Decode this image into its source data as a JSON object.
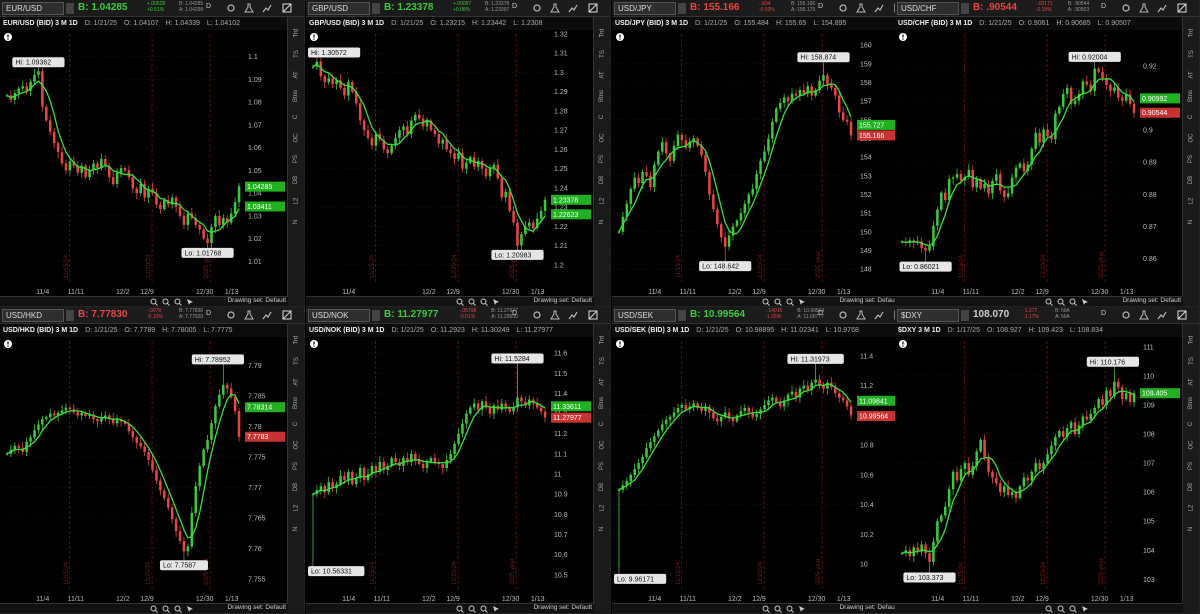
{
  "colors": {
    "up": "#3acb3a",
    "down": "#e84545",
    "ma": "#38e038",
    "bg": "#000000",
    "grid": "#2a2a2a",
    "vline": "#9a1515"
  },
  "panels": [
    {
      "symbol": "EUR/USD",
      "bid": "B: 1.04285",
      "bid_color": "#3acb3a",
      "change": [
        "+.00528",
        "+0.51%"
      ],
      "change_color": "#3acb3a",
      "bidask": [
        "B: 1.04285",
        "A: 1.04299"
      ],
      "info": {
        "title": "EUR/USD (BID) 3 M 1D",
        "d": "D: 1/21/25",
        "o": "O: 1.04107",
        "h": "H: 1.04339",
        "l": "L: 1.04102"
      },
      "hi_label": "Hi: 1.09362",
      "lo_label": "Lo: 1.01768",
      "badges": [
        {
          "text": "1.04285",
          "color": "#20b020"
        },
        {
          "text": "1.03411",
          "color": "#20b020"
        }
      ],
      "drawing": "Drawing set: Default",
      "chart_data": {
        "type": "candlestick",
        "ylim": [
          1.0,
          1.11
        ],
        "yticks": [
          "1.1",
          "1.09",
          "1.08",
          "1.07",
          "1.06",
          "1.05",
          "1.04",
          "1.03",
          "1.02",
          "1.01"
        ],
        "xticks": [
          "11/4",
          "11/11",
          "12/2",
          "12/9",
          "12/30",
          "1/13"
        ],
        "vlines": [
          "11/15/24",
          "12/20/24",
          "2025 year"
        ],
        "close": [
          1.083,
          1.081,
          1.084,
          1.086,
          1.087,
          1.085,
          1.089,
          1.092,
          1.0936,
          1.078,
          1.072,
          1.067,
          1.062,
          1.058,
          1.053,
          1.05,
          1.054,
          1.052,
          1.049,
          1.052,
          1.047,
          1.05,
          1.053,
          1.051,
          1.055,
          1.052,
          1.047,
          1.044,
          1.049,
          1.051,
          1.05,
          1.047,
          1.042,
          1.04,
          1.044,
          1.038,
          1.042,
          1.04,
          1.035,
          1.033,
          1.037,
          1.035,
          1.038,
          1.034,
          1.03,
          1.026,
          1.031,
          1.029,
          1.026,
          1.024,
          1.02,
          1.018,
          1.025,
          1.03,
          1.026,
          1.029,
          1.027,
          1.031,
          1.036,
          1.043
        ],
        "last": 1.04285,
        "hi": 1.09362,
        "lo": 1.01768
      }
    },
    {
      "symbol": "GBP/USD",
      "bid": "B: 1.23378",
      "bid_color": "#3acb3a",
      "change": [
        "+.00097",
        "+0.08%"
      ],
      "change_color": "#3acb3a",
      "bidask": [
        "B: 1.23378",
        "A: 1.23397"
      ],
      "info": {
        "title": "GBP/USD (BID) 3 M 1D",
        "d": "D: 1/21/25",
        "o": "O: 1.23215",
        "h": "H: 1.23442",
        "l": "L: 1.2308"
      },
      "hi_label": "Hi: 1.30572",
      "lo_label": "Lo: 1.20983",
      "badges": [
        {
          "text": "1.23378",
          "color": "#20b020"
        },
        {
          "text": "1.22623",
          "color": "#20b020"
        }
      ],
      "drawing": "Drawing set: Default",
      "chart_data": {
        "type": "candlestick",
        "ylim": [
          1.19,
          1.32
        ],
        "yticks": [
          "1.32",
          "1.31",
          "1.3",
          "1.29",
          "1.28",
          "1.27",
          "1.26",
          "1.25",
          "1.24",
          "1.23",
          "1.22",
          "1.21",
          "1.2"
        ],
        "xticks": [
          "11/4",
          "12/2",
          "12/9",
          "12/30",
          "1/13"
        ],
        "vlines": [
          "11/15/24",
          "12/20/24",
          "2025 year"
        ],
        "close": [
          1.303,
          1.3057,
          1.298,
          1.295,
          1.297,
          1.294,
          1.296,
          1.292,
          1.288,
          1.295,
          1.29,
          1.284,
          1.275,
          1.27,
          1.266,
          1.262,
          1.268,
          1.265,
          1.26,
          1.258,
          1.262,
          1.266,
          1.27,
          1.272,
          1.268,
          1.275,
          1.278,
          1.276,
          1.272,
          1.275,
          1.27,
          1.268,
          1.263,
          1.265,
          1.26,
          1.258,
          1.255,
          1.258,
          1.25,
          1.253,
          1.256,
          1.251,
          1.254,
          1.25,
          1.246,
          1.25,
          1.252,
          1.245,
          1.235,
          1.238,
          1.228,
          1.222,
          1.21,
          1.216,
          1.22,
          1.222,
          1.219,
          1.224,
          1.228,
          1.2338
        ],
        "last": 1.23378,
        "hi": 1.30572,
        "lo": 1.20983
      }
    },
    {
      "symbol": "USD/JPY",
      "bid": "B: 155.166",
      "bid_color": "#e84545",
      "change": [
        "-.834",
        "-0.53%"
      ],
      "change_color": "#e84545",
      "bidask": [
        "B: 155.166",
        "A: 155.179"
      ],
      "info": {
        "title": "USD/JPY (BID) 3 M 1D",
        "d": "D: 1/21/25",
        "o": "O: 155.484",
        "h": "H: 155.65",
        "l": "L: 154.895"
      },
      "hi_label": "Hi: 158.874",
      "lo_label": "Lo: 148.642",
      "badges": [
        {
          "text": "155.727",
          "color": "#20b020"
        },
        {
          "text": "155.166",
          "color": "#c83232"
        }
      ],
      "drawing": "Drawing set: Default",
      "chart_data": {
        "type": "candlestick",
        "ylim": [
          147.2,
          160.6
        ],
        "yticks": [
          "160",
          "159",
          "158",
          "157",
          "156",
          "155",
          "154",
          "153",
          "152",
          "151",
          "150",
          "149",
          "148"
        ],
        "xticks": [
          "11/4",
          "11/11",
          "12/2",
          "12/9",
          "12/30",
          "1/13"
        ],
        "vlines": [
          "11/15/24",
          "12/20/24",
          "2025 year"
        ],
        "close": [
          150.0,
          150.8,
          151.5,
          152.3,
          152.9,
          152.6,
          153.2,
          153.0,
          152.4,
          153.6,
          154.3,
          154.8,
          154.2,
          153.8,
          154.6,
          155.2,
          154.9,
          154.5,
          154.8,
          155.0,
          154.6,
          154.1,
          153.2,
          152.0,
          151.2,
          150.4,
          149.7,
          149.2,
          149.8,
          150.3,
          150.6,
          151.0,
          151.5,
          152.0,
          152.3,
          153.1,
          153.8,
          154.3,
          155.0,
          155.9,
          156.6,
          156.9,
          157.2,
          157.0,
          157.4,
          157.3,
          157.6,
          157.4,
          157.8,
          157.3,
          157.6,
          158.1,
          158.4,
          157.9,
          157.7,
          157.3,
          156.4,
          156.0,
          155.9,
          155.166
        ],
        "last": 155.166,
        "hi": 158.874,
        "lo": 148.642
      }
    },
    {
      "symbol": "USD/CHF",
      "bid": "B: .90544",
      "bid_color": "#e84545",
      "change": [
        "-.00171",
        "-0.19%"
      ],
      "change_color": "#e84545",
      "bidask": [
        "B: .90544",
        "A: .90563"
      ],
      "info": {
        "title": "USD/CHF (BID) 3 M 1D",
        "d": "D: 1/21/25",
        "o": "O: 0.9061",
        "h": "H: 0.90685",
        "l": "L: 0.90507"
      },
      "hi_label": "Hi: 0.92004",
      "lo_label": "Lo: 0.86021",
      "badges": [
        {
          "text": "0.90992",
          "color": "#20b020"
        },
        {
          "text": "0.90544",
          "color": "#c83232"
        }
      ],
      "drawing": "Drawing set: Default",
      "chart_data": {
        "type": "candlestick",
        "ylim": [
          0.852,
          0.93
        ],
        "yticks": [
          "0.92",
          "0.91",
          "0.9",
          "0.89",
          "0.88",
          "0.87",
          "0.86"
        ],
        "xticks": [
          "11/4",
          "11/11",
          "12/2",
          "12/9",
          "12/30",
          "1/13"
        ],
        "vlines": [
          "11/15/24",
          "12/20/24",
          "2025 year"
        ],
        "close": [
          0.8652,
          0.8648,
          0.8656,
          0.8649,
          0.8653,
          0.8632,
          0.8624,
          0.8637,
          0.8702,
          0.8752,
          0.8805,
          0.8782,
          0.8848,
          0.8852,
          0.8863,
          0.8843,
          0.8854,
          0.8876,
          0.8822,
          0.8848,
          0.8818,
          0.8832,
          0.8803,
          0.8842,
          0.8862,
          0.8812,
          0.8792,
          0.8803,
          0.8852,
          0.8883,
          0.8896,
          0.8873,
          0.8893,
          0.8942,
          0.8992,
          0.8962,
          0.9002,
          0.8982,
          0.8972,
          0.9052,
          0.9073,
          0.9113,
          0.9132,
          0.9082,
          0.9092,
          0.9113,
          0.9152,
          0.9142,
          0.9122,
          0.9192,
          0.9182,
          0.9162,
          0.9141,
          0.9122,
          0.9133,
          0.9102,
          0.9092,
          0.9112,
          0.9082,
          0.9054
        ],
        "last": 0.90544,
        "hi": 0.92004,
        "lo": 0.86021
      }
    },
    {
      "symbol": "USD/HKD",
      "bid": "B: 7.77830",
      "bid_color": "#e84545",
      "change": [
        "-.0079",
        "-0.10%"
      ],
      "change_color": "#e84545",
      "bidask": [
        "B: 7.77830",
        "A: 7.77920"
      ],
      "info": {
        "title": "USD/HKD (BID) 3 M 1D",
        "d": "D: 1/21/25",
        "o": "O: 7.7789",
        "h": "H: 7.78005",
        "l": "L: 7.7775"
      },
      "hi_label": "Hi: 7.78952",
      "lo_label": "Lo: 7.7587",
      "badges": [
        {
          "text": "7.78314",
          "color": "#20b020"
        },
        {
          "text": "7.7783",
          "color": "#c83232"
        }
      ],
      "drawing": "Drawing set: Default",
      "chart_data": {
        "type": "candlestick",
        "ylim": [
          7.753,
          7.794
        ],
        "yticks": [
          "7.79",
          "7.785",
          "7.78",
          "7.775",
          "7.77",
          "7.765",
          "7.76",
          "7.755"
        ],
        "xticks": [
          "11/4",
          "11/11",
          "12/2",
          "12/9",
          "12/30",
          "1/13"
        ],
        "vlines": [
          "11/15/24",
          "12/20/24",
          "2025 year"
        ],
        "close": [
          7.7755,
          7.7762,
          7.7768,
          7.7765,
          7.7758,
          7.7775,
          7.7782,
          7.7794,
          7.7803,
          7.7812,
          7.7815,
          7.7821,
          7.7818,
          7.7822,
          7.7826,
          7.7831,
          7.7828,
          7.7823,
          7.7818,
          7.7822,
          7.7817,
          7.7819,
          7.7812,
          7.7808,
          7.7815,
          7.7818,
          7.7812,
          7.7805,
          7.7811,
          7.7808,
          7.7804,
          7.7792,
          7.7782,
          7.7773,
          7.7767,
          7.7758,
          7.7745,
          7.7728,
          7.7711,
          7.7695,
          7.7682,
          7.7667,
          7.7648,
          7.7628,
          7.7612,
          7.7595,
          7.7603,
          7.7658,
          7.7702,
          7.7735,
          7.7762,
          7.7778,
          7.7805,
          7.7833,
          7.7852,
          7.7868,
          7.7862,
          7.7848,
          7.7825,
          7.7783
        ],
        "last": 7.7783,
        "hi": 7.78952,
        "lo": 7.7587
      }
    },
    {
      "symbol": "USD/NOK",
      "bid": "B: 11.27977",
      "bid_color": "#3acb3a",
      "change": [
        "-.05798",
        "-0.51%"
      ],
      "change_color": "#e84545",
      "bidask": [
        "B: 11.27977",
        "A: 11.29500"
      ],
      "info": {
        "title": "USD/NOK (BID) 3 M 1D",
        "d": "D: 1/21/25",
        "o": "O: 11.2923",
        "h": "H: 11.30249",
        "l": "L: 11.27977"
      },
      "hi_label": "Hi: 11.5284",
      "lo_label": "Lo: 10.56331",
      "badges": [
        {
          "text": "11.33611",
          "color": "#20b020"
        },
        {
          "text": "11.27977",
          "color": "#c83232"
        }
      ],
      "drawing": "Drawing set: Default",
      "chart_data": {
        "type": "candlestick",
        "ylim": [
          10.42,
          11.66
        ],
        "yticks": [
          "11.6",
          "11.5",
          "11.4",
          "11.3",
          "11.2",
          "11.1",
          "11",
          "10.9",
          "10.8",
          "10.7",
          "10.6",
          "10.5"
        ],
        "xticks": [
          "11/4",
          "11/11",
          "12/2",
          "12/9",
          "12/30",
          "1/13"
        ],
        "vlines": [
          "11/15/24",
          "12/20/24",
          "2025 year"
        ],
        "close": [
          10.9,
          10.92,
          10.94,
          10.91,
          10.96,
          10.93,
          10.95,
          10.99,
          10.97,
          11.01,
          10.95,
          10.98,
          11.03,
          10.97,
          11.0,
          11.04,
          11.01,
          11.06,
          11.02,
          11.04,
          11.08,
          11.06,
          11.04,
          11.08,
          11.06,
          11.1,
          11.07,
          11.05,
          11.03,
          11.06,
          11.08,
          11.06,
          11.05,
          11.03,
          11.07,
          11.1,
          11.15,
          11.2,
          11.25,
          11.3,
          11.33,
          11.35,
          11.32,
          11.36,
          11.33,
          11.3,
          11.34,
          11.32,
          11.35,
          11.33,
          11.31,
          11.33,
          11.38,
          11.36,
          11.34,
          11.37,
          11.35,
          11.33,
          11.31,
          11.28
        ],
        "last": 11.27977,
        "hi": 11.5284,
        "lo": 10.56331
      }
    },
    {
      "symbol": "USD/SEK",
      "bid": "B: 10.99564",
      "bid_color": "#3acb3a",
      "change": [
        "-.14016",
        "-1.26%"
      ],
      "change_color": "#e84545",
      "bidask": [
        "B: 10.99564",
        "A: 11.00777"
      ],
      "info": {
        "title": "USD/SEK (BID) 3 M 1D",
        "d": "D: 1/21/25",
        "o": "O: 10.98895",
        "h": "H: 11.02341",
        "l": "L: 10.9768"
      },
      "hi_label": "Hi: 11.31973",
      "lo_label": "Lo: 9.96171",
      "badges": [
        {
          "text": "11.09841",
          "color": "#20b020"
        },
        {
          "text": "10.99564",
          "color": "#c83232"
        }
      ],
      "drawing": "Drawing set: Default",
      "chart_data": {
        "type": "candlestick",
        "ylim": [
          9.82,
          11.5
        ],
        "yticks": [
          "11.4",
          "11.2",
          "11",
          "10.8",
          "10.6",
          "10.4",
          "10.2",
          "10"
        ],
        "xticks": [
          "11/4",
          "11/11",
          "12/2",
          "12/9",
          "12/30",
          "1/13"
        ],
        "vlines": [
          "11/15/24",
          "12/20/24",
          "2025 year"
        ],
        "close": [
          10.5,
          10.53,
          10.56,
          10.6,
          10.64,
          10.68,
          10.72,
          10.78,
          10.82,
          10.86,
          10.9,
          10.94,
          10.97,
          10.99,
          11.02,
          11.05,
          11.07,
          11.04,
          11.06,
          11.08,
          11.05,
          11.03,
          11.06,
          11.02,
          10.98,
          10.96,
          10.99,
          11.02,
          10.98,
          10.96,
          11.0,
          11.03,
          11.05,
          11.02,
          10.99,
          11.01,
          11.04,
          11.07,
          11.1,
          11.12,
          11.09,
          11.06,
          11.1,
          11.14,
          11.16,
          11.12,
          11.18,
          11.2,
          11.17,
          11.22,
          11.24,
          11.2,
          11.18,
          11.22,
          11.19,
          11.15,
          11.12,
          11.1,
          11.06,
          11.0
        ],
        "last": 10.99564,
        "hi": 11.31973,
        "lo": 9.96171
      }
    },
    {
      "symbol": "$DXY",
      "bid": "108.070",
      "bid_color": "#d0d0d0",
      "change": [
        "-1.277",
        "-1.17%"
      ],
      "change_color": "#e84545",
      "bidask": [
        "B: N/A",
        "A: N/A"
      ],
      "info": {
        "title": "$DXY 3 M 1D",
        "d": "D: 1/17/25",
        "o": "O: 108.927",
        "h": "H: 109.423",
        "l": "L: 108.834"
      },
      "hi_label": "Hi: 110.176",
      "lo_label": "Lo: 103.373",
      "badges": [
        {
          "text": "109.405",
          "color": "#20b020"
        }
      ],
      "drawing": "",
      "chart_data": {
        "type": "candlestick",
        "ylim": [
          102.6,
          111.2
        ],
        "yticks": [
          "111",
          "110",
          "109",
          "108",
          "107",
          "106",
          "105",
          "104",
          "103"
        ],
        "xticks": [
          "11/4",
          "11/11",
          "12/2",
          "12/9",
          "12/30",
          "1/13"
        ],
        "vlines": [
          "11/15/24",
          "12/20/24",
          "2025 year"
        ],
        "close": [
          103.9,
          104.0,
          103.8,
          104.1,
          103.95,
          104.2,
          103.9,
          103.6,
          104.3,
          105.0,
          105.2,
          105.5,
          106.1,
          106.7,
          106.4,
          106.8,
          107.0,
          106.6,
          106.9,
          107.4,
          107.8,
          107.2,
          106.7,
          106.5,
          106.3,
          106.0,
          106.2,
          105.9,
          106.0,
          105.8,
          106.2,
          106.5,
          106.4,
          106.7,
          107.0,
          106.8,
          107.0,
          107.3,
          107.6,
          107.9,
          108.1,
          107.9,
          108.2,
          108.4,
          108.0,
          108.3,
          108.6,
          108.5,
          108.7,
          108.9,
          109.2,
          109.0,
          109.5,
          109.3,
          109.8,
          109.6,
          109.2,
          109.4,
          109.1,
          109.4
        ],
        "last": 109.405,
        "hi": 110.176,
        "lo": 103.373
      }
    }
  ],
  "side_strip": [
    "Trd",
    "TS",
    "AT",
    "Btns",
    "C",
    "OC",
    "PS",
    "DB",
    "L2",
    "N"
  ],
  "toolbar": {
    "d_label": "D"
  },
  "icons": [
    "symbol-dropdown-icon",
    "studies-icon",
    "settings-icon",
    "crosshair-icon",
    "zoom-icon",
    "zoom-out-icon",
    "pointer-icon",
    "flask-icon",
    "chart-style-icon",
    "info-icon"
  ]
}
